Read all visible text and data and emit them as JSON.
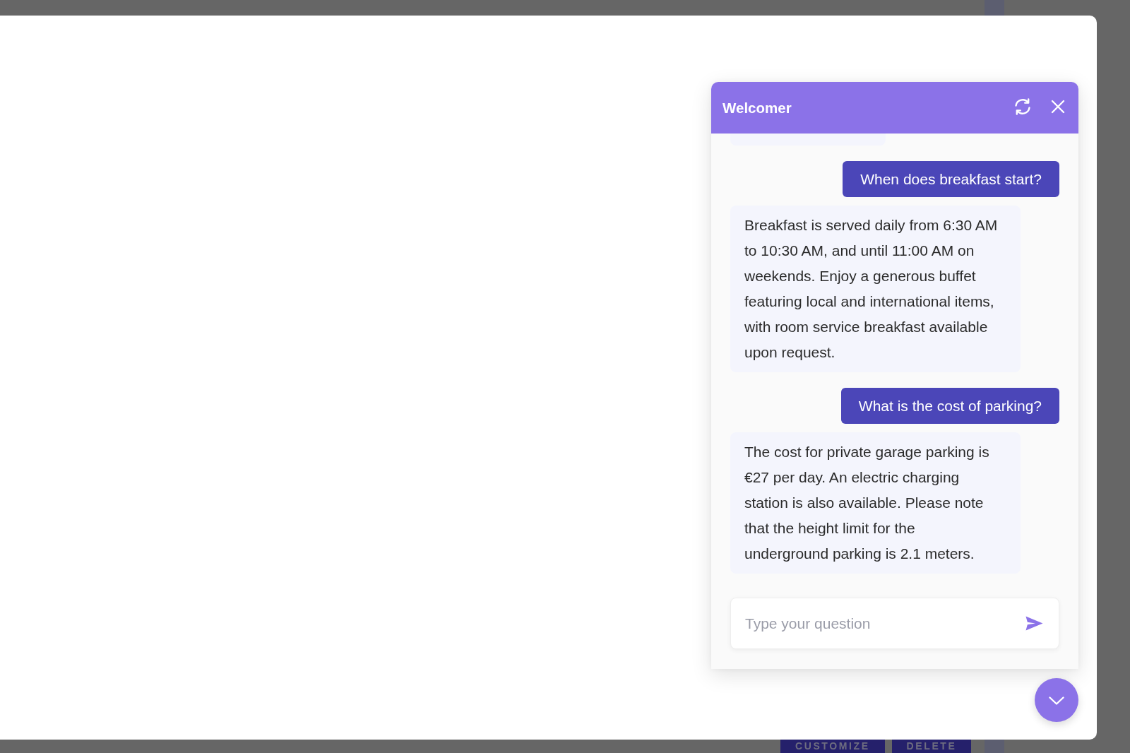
{
  "backdrop": {
    "buttons": [
      "CUSTOMIZE",
      "DELETE"
    ]
  },
  "chat": {
    "title": "Welcomer",
    "messages": [
      {
        "kind": "clipped"
      },
      {
        "kind": "user",
        "text": "When does breakfast start?"
      },
      {
        "kind": "bot",
        "text": "Breakfast is served daily from 6:30 AM to 10:30 AM, and until 11:00 AM on weekends. Enjoy a generous buffet featuring local and international items, with room service breakfast available upon request."
      },
      {
        "kind": "user",
        "text": "What is the cost of parking?"
      },
      {
        "kind": "bot",
        "text": "The cost for private garage parking is €27 per day. An electric charging station is also available. Please note that the height limit for the underground parking is 2.1 meters."
      }
    ],
    "input": {
      "placeholder": "Type your question"
    }
  }
}
